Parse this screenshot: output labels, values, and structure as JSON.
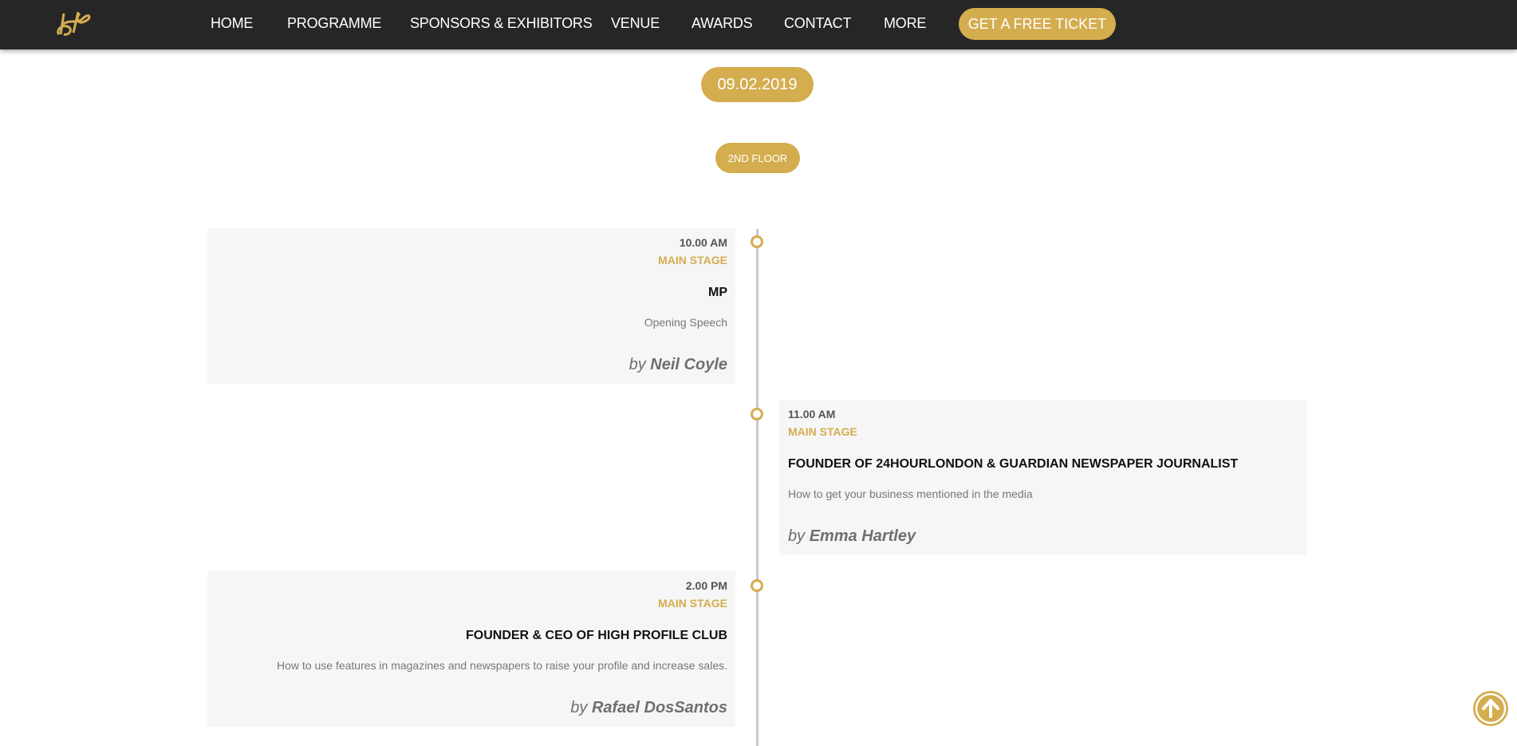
{
  "header": {
    "logo_icon": "hp-monogram-logo",
    "nav": [
      {
        "label": "HOME"
      },
      {
        "label": "PROGRAMME"
      },
      {
        "label": "SPONSORS & EXHIBITORS"
      },
      {
        "label": "VENUE"
      },
      {
        "label": "AWARDS"
      },
      {
        "label": "CONTACT"
      },
      {
        "label": "MORE"
      }
    ],
    "cta_label": "GET A FREE TICKET"
  },
  "programme": {
    "date": "09.02.2019",
    "floor": "2ND FLOOR",
    "by_prefix": "by",
    "sessions": [
      {
        "time": "10.00 AM",
        "stage": "MAIN STAGE",
        "role": "MP",
        "description": "Opening Speech",
        "speaker": "Neil Coyle"
      },
      {
        "time": "11.00 AM",
        "stage": "MAIN STAGE",
        "role": "FOUNDER OF 24HOURLONDON & GUARDIAN NEWSPAPER JOURNALIST",
        "description": "How to get your business mentioned in the media",
        "speaker": "Emma Hartley"
      },
      {
        "time": "2.00 PM",
        "stage": "MAIN STAGE",
        "role": "FOUNDER & CEO OF HIGH PROFILE CLUB",
        "description": "How to use features in magazines and newspapers to raise your profile and increase sales.",
        "speaker": "Rafael DosSantos"
      }
    ]
  },
  "scroll_top_icon": "arrow-up-circle-icon",
  "colors": {
    "accent": "#d4ad4f",
    "header_bg": "#262626",
    "card_bg": "#f6f6f6",
    "timeline": "#c9c9c9"
  }
}
